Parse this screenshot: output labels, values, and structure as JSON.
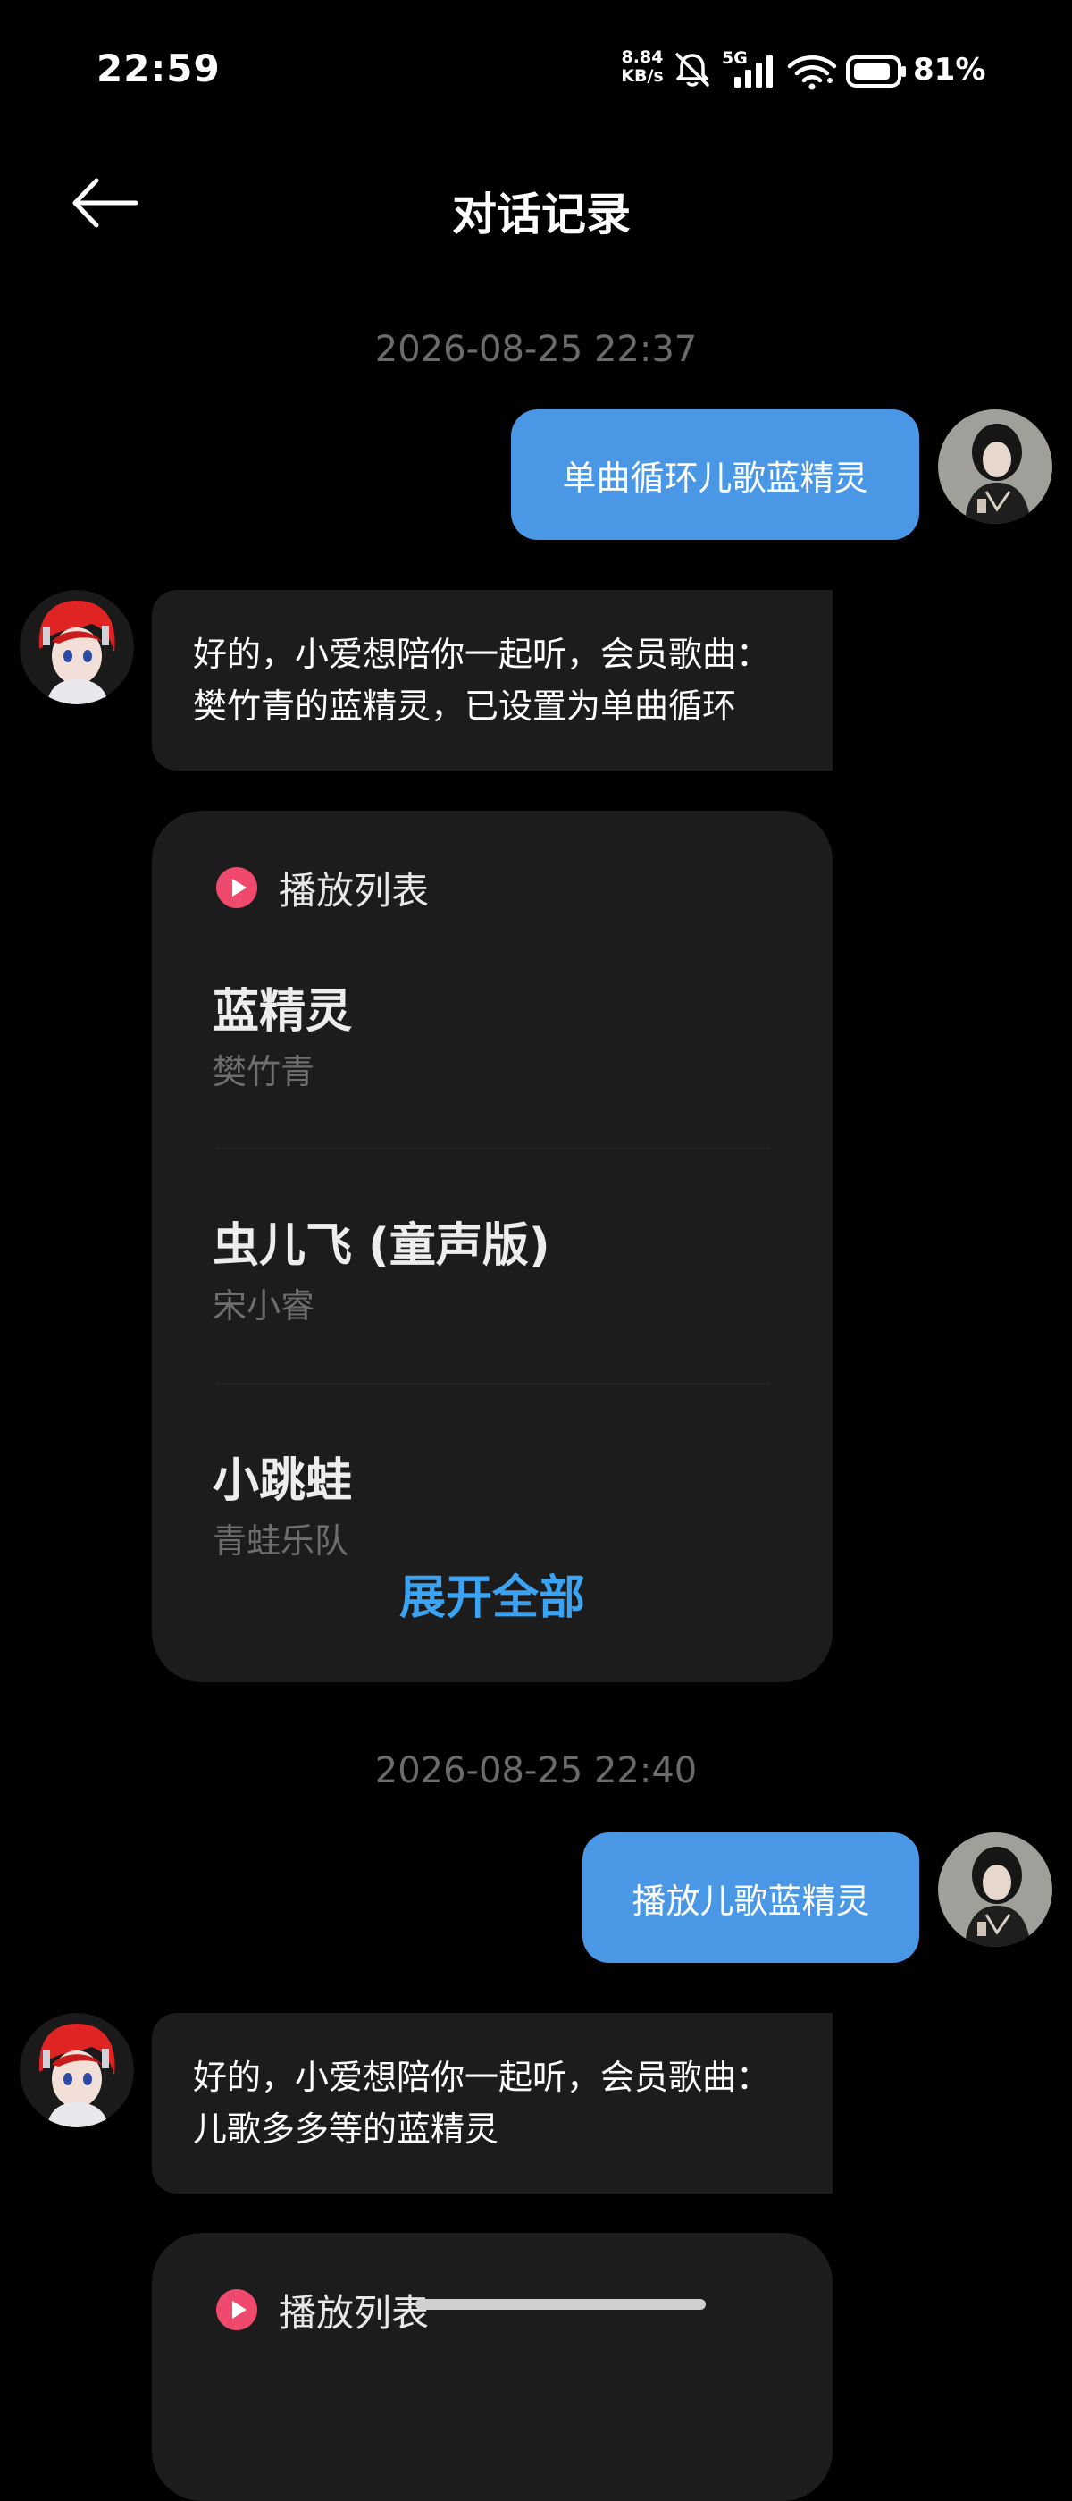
{
  "status_bar": {
    "time": "22:59",
    "net_speed_value": "8.84",
    "net_speed_unit": "KB/s",
    "network": "5G",
    "battery": "81%",
    "icons": [
      "mute-bell-icon",
      "signal-icon",
      "wifi-icon",
      "battery-icon"
    ]
  },
  "nav": {
    "back_icon": "arrow-left-icon",
    "title": "对话记录"
  },
  "conversation": [
    {
      "timestamp": "2026-08-25 22:37",
      "user_message": "单曲循环儿歌蓝精灵",
      "ai_reply_lines": [
        "好的，小爱想陪你一起听，会员歌曲：",
        "樊竹青的蓝精灵，已设置为单曲循环"
      ],
      "playlist": {
        "title": "播放列表",
        "songs": [
          {
            "title": "蓝精灵",
            "artist": "樊竹青"
          },
          {
            "title": "虫儿飞 (童声版)",
            "artist": "宋小睿"
          },
          {
            "title": "小跳蛙",
            "artist": "青蛙乐队"
          }
        ],
        "expand_label": "展开全部"
      }
    },
    {
      "timestamp": "2026-08-25 22:40",
      "user_message": "播放儿歌蓝精灵",
      "ai_reply_lines": [
        "好的，小爱想陪你一起听，会员歌曲：",
        "儿歌多多等的蓝精灵"
      ],
      "playlist": {
        "title": "播放列表"
      }
    }
  ],
  "colors": {
    "background": "#000000",
    "user_bubble": "#4a97e6",
    "ai_bubble": "#1c1c1c",
    "accent_link": "#3aa3f3",
    "play_icon": "#ef4a6d"
  }
}
